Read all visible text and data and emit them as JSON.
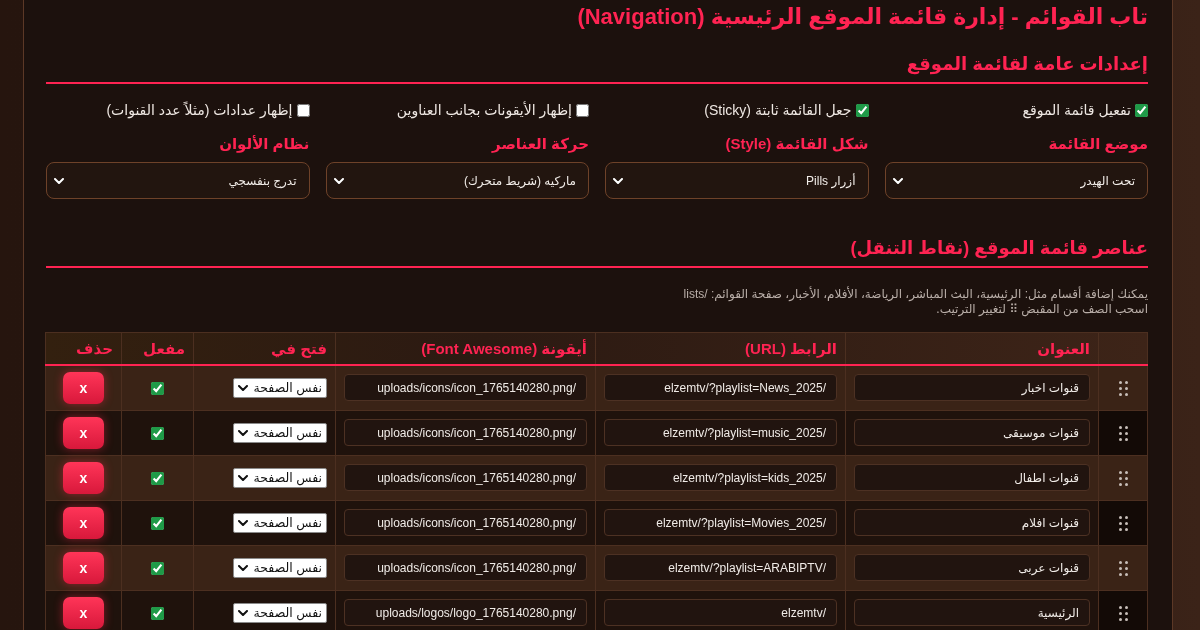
{
  "title": "تاب القوائم - إدارة قائمة الموقع الرئيسية (Navigation)",
  "general_settings": {
    "heading": "إعدادات عامة لقائمة الموقع",
    "toggles": [
      {
        "label": "تفعيل قائمة الموقع",
        "checked": true
      },
      {
        "label": "جعل القائمة ثابتة (Sticky)",
        "checked": true
      },
      {
        "label": "إظهار الأيقونات بجانب العناوين",
        "checked": false
      },
      {
        "label": "إظهار عدادات (مثلاً عدد القنوات)",
        "checked": false
      }
    ],
    "selects": [
      {
        "label": "موضع القائمة",
        "value": "تحت الهيدر"
      },
      {
        "label": "شكل القائمة (Style)",
        "value": "أزرار Pills"
      },
      {
        "label": "حركة العناصر",
        "value": "ماركيه (شريط متحرك)"
      },
      {
        "label": "نظام الألوان",
        "value": "تدرج بنفسجي"
      }
    ]
  },
  "items_section": {
    "heading": "عناصر قائمة الموقع (نقاط التنقل)",
    "help_lines": [
      "يمكنك إضافة أقسام مثل: الرئيسية، البث المباشر، الرياضة، الأفلام، الأخبار، صفحة القوائم: /lists",
      "اسحب الصف من المقبض ⠿ لتغيير الترتيب."
    ],
    "table": {
      "columns": [
        "العنوان",
        "الرابط (URL)",
        "أيقونة (Font Awesome)",
        "فتح في",
        "مفعل",
        "حذف"
      ],
      "rows": [
        {
          "title": "قنوات اخبار",
          "url": "/elzemtv/?playlist=News_2025",
          "icon": "/uploads/icons/icon_1765140280.png",
          "open_in": "نفس الصفحة",
          "enabled": true,
          "delete_label": "x"
        },
        {
          "title": "قنوات موسيقى",
          "url": "/elzemtv/?playlist=music_2025",
          "icon": "/uploads/icons/icon_1765140280.png",
          "open_in": "نفس الصفحة",
          "enabled": true,
          "delete_label": "x"
        },
        {
          "title": "قنوات اطفال",
          "url": "/elzemtv/?playlist=kids_2025",
          "icon": "/uploads/icons/icon_1765140280.png",
          "open_in": "نفس الصفحة",
          "enabled": true,
          "delete_label": "x"
        },
        {
          "title": "قنوات افلام",
          "url": "/elzemtv/?playlist=Movies_2025",
          "icon": "/uploads/icons/icon_1765140280.png",
          "open_in": "نفس الصفحة",
          "enabled": true,
          "delete_label": "x"
        },
        {
          "title": "قنوات عربى",
          "url": "/elzemtv/?playlist=ARABIPTV",
          "icon": "/uploads/icons/icon_1765140280.png",
          "open_in": "نفس الصفحة",
          "enabled": true,
          "delete_label": "x"
        },
        {
          "title": "الرئيسية",
          "url": "/elzemtv",
          "icon": "/uploads/logos/logo_1765140280.png",
          "open_in": "نفس الصفحة",
          "enabled": true,
          "delete_label": "x"
        }
      ]
    }
  }
}
